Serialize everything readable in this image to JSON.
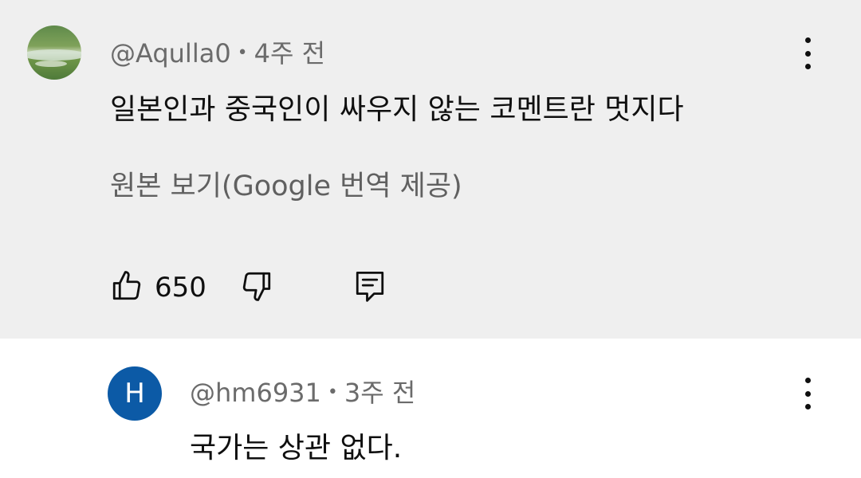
{
  "comment": {
    "author": "@Aqulla0",
    "separator": "•",
    "time": "4주 전",
    "text": "일본인과 중국인이 싸우지 않는 코멘트란 멋지다",
    "translate_link": "원본 보기(Google 번역 제공)",
    "like_count": "650",
    "icons": {
      "like": "thumbs-up-icon",
      "dislike": "thumbs-down-icon",
      "reply": "reply-comment-icon",
      "more": "more-vert-icon"
    }
  },
  "reply": {
    "avatar_letter": "H",
    "avatar_color": "#0c5aa6",
    "author": "@hm6931",
    "separator": "•",
    "time": "3주 전",
    "text": "국가는 상관 없다."
  },
  "colors": {
    "top_background": "#efefef",
    "reply_background": "#ffffff",
    "meta_text": "#6b6b6b",
    "body_text": "#0f0f0f"
  }
}
